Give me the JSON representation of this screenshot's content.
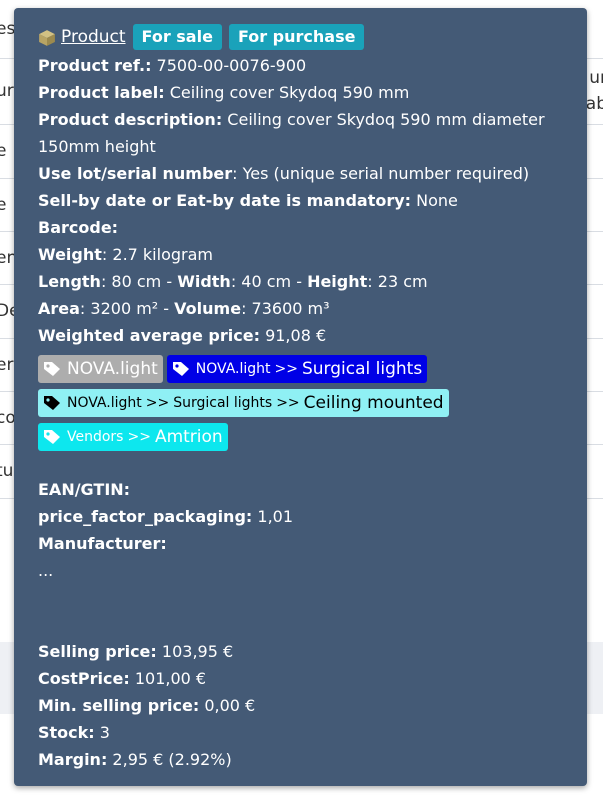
{
  "background": {
    "rows": [
      {
        "left": "es",
        "right": ""
      },
      {
        "left": "ur",
        "right": "ur"
      },
      {
        "left": "e",
        "right": ""
      },
      {
        "left": "e",
        "right": ""
      },
      {
        "left": "en",
        "right": ""
      },
      {
        "left": "De",
        "right": ""
      },
      {
        "left": "er",
        "right": ""
      },
      {
        "left": "co",
        "right": ""
      },
      {
        "left": "tu",
        "right": ""
      }
    ],
    "right_extra": "ab"
  },
  "tooltip": {
    "title_link": "Product",
    "badge_sale": "For sale",
    "badge_purchase": "For purchase",
    "ref_label": "Product ref.:",
    "ref_value": " 7500-00-0076-900",
    "label_label": "Product label:",
    "label_value": " Ceiling cover Skydoq 590 mm",
    "desc_label": "Product description:",
    "desc_value": " Ceiling cover Skydoq 590 mm diameter 150mm height",
    "lot_label": "Use lot/serial number",
    "lot_value": ": Yes (unique serial number required)",
    "sellby_label": "Sell-by date or Eat-by date is mandatory:",
    "sellby_value": " None",
    "barcode_label": "Barcode:",
    "weight_label": "Weight",
    "weight_value": ": 2.7 kilogram",
    "length_label": "Length",
    "length_value": ": 80 cm - ",
    "width_label": "Width",
    "width_value": ": 40 cm - ",
    "height_label": "Height",
    "height_value": ": 23 cm",
    "area_label": "Area",
    "area_value": ": 3200 m² - ",
    "volume_label": "Volume",
    "volume_value": ": 73600 m³",
    "wap_label": "Weighted average price:",
    "wap_value": " 91,08 €",
    "tags": [
      {
        "parts": [
          "NOVA.light"
        ],
        "bg": "#adadad",
        "fg": "#ffffff"
      },
      {
        "parts": [
          "NOVA.light",
          "Surgical lights"
        ],
        "bg": "#0000e6",
        "fg": "#ffffff"
      },
      {
        "parts": [
          "NOVA.light",
          "Surgical lights",
          "Ceiling mounted"
        ],
        "bg": "#8ff0f4",
        "fg": "#000000"
      },
      {
        "parts": [
          "Vendors",
          "Amtrion"
        ],
        "bg": "#0de7ee",
        "fg": "#ffffff"
      }
    ],
    "tag_separator": ">>",
    "ean_label": "EAN/GTIN:",
    "pfp_label": "price_factor_packaging:",
    "pfp_value": " 1,01",
    "manufacturer_label": "Manufacturer:",
    "ellipsis": "...",
    "selling_label": "Selling price:",
    "selling_value": " 103,95 €",
    "cost_label": "CostPrice:",
    "cost_value": " 101,00 €",
    "minsell_label": "Min. selling price:",
    "minsell_value": " 0,00 €",
    "stock_label": "Stock:",
    "stock_value": " 3",
    "margin_label": "Margin:",
    "margin_value": " 2,95 € (2.92%)"
  },
  "colors": {
    "tooltip_bg": "#445a76",
    "badge_bg": "#1aa2ba",
    "box_icon": "#b8a464"
  }
}
